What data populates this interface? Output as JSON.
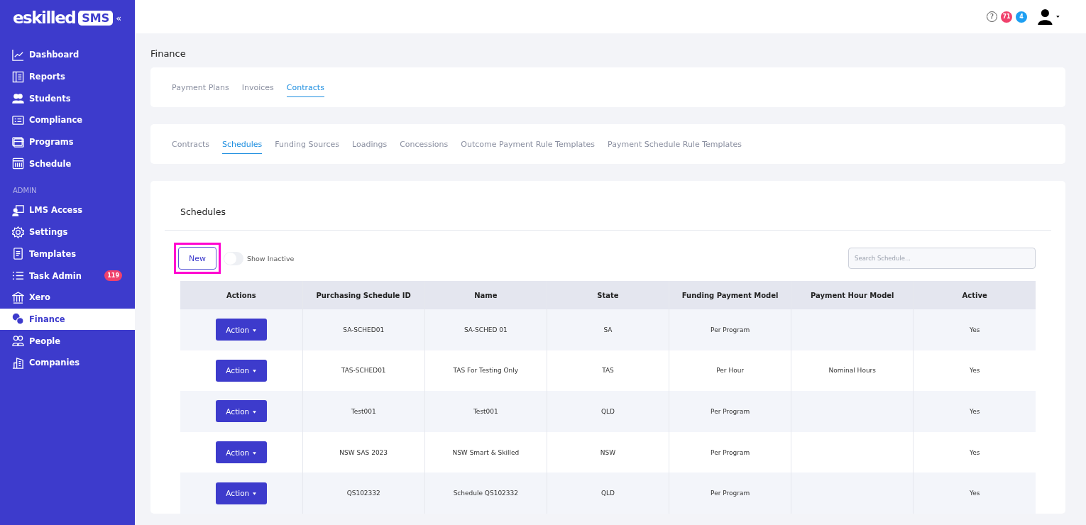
{
  "logo": {
    "brand": "skilled",
    "brand_initial": "e",
    "product": "SMS",
    "collapse": "«"
  },
  "sidebar": {
    "items": [
      {
        "label": "Dashboard",
        "selected": false
      },
      {
        "label": "Reports",
        "selected": false
      },
      {
        "label": "Students",
        "selected": false
      },
      {
        "label": "Compliance",
        "selected": false
      },
      {
        "label": "Programs",
        "selected": false
      },
      {
        "label": "Schedule",
        "selected": false
      }
    ],
    "admin_heading": "ADMIN",
    "admin_items": [
      {
        "label": "LMS Access",
        "selected": false
      },
      {
        "label": "Settings",
        "selected": false
      },
      {
        "label": "Templates",
        "selected": false
      },
      {
        "label": "Task Admin",
        "selected": false,
        "badge": "119"
      },
      {
        "label": "Xero",
        "selected": false
      },
      {
        "label": "Finance",
        "selected": true
      },
      {
        "label": "People",
        "selected": false
      },
      {
        "label": "Companies",
        "selected": false
      }
    ]
  },
  "header": {
    "help": "?",
    "badges": [
      {
        "count": "71",
        "color": "#f0416c"
      },
      {
        "count": "4",
        "color": "#1e9ff2"
      }
    ]
  },
  "page_title": "Finance",
  "tabs": [
    {
      "label": "Payment Plans",
      "selected": false
    },
    {
      "label": "Invoices",
      "selected": false
    },
    {
      "label": "Contracts",
      "selected": true
    }
  ],
  "subtabs": [
    {
      "label": "Contracts",
      "selected": false
    },
    {
      "label": "Schedules",
      "selected": true
    },
    {
      "label": "Funding Sources",
      "selected": false
    },
    {
      "label": "Loadings",
      "selected": false
    },
    {
      "label": "Concessions",
      "selected": false
    },
    {
      "label": "Outcome Payment Rule Templates",
      "selected": false
    },
    {
      "label": "Payment Schedule Rule Templates",
      "selected": false
    }
  ],
  "panel": {
    "title": "Schedules",
    "new_button": {
      "label": "New",
      "highlighted": true
    },
    "show_inactive": {
      "label": "Show Inactive",
      "on": false
    },
    "search": {
      "placeholder": "Search Schedule..."
    }
  },
  "table": {
    "columns": [
      "Actions",
      "Purchasing Schedule ID",
      "Name",
      "State",
      "Funding Payment Model",
      "Payment Hour Model",
      "Active"
    ],
    "rows": [
      {
        "cells": [
          "Action",
          "SA-SCHED01",
          "SA-SCHED 01",
          "SA",
          "Per Program",
          "",
          "Yes"
        ]
      },
      {
        "cells": [
          "Action",
          "TAS-SCHED01",
          "TAS For Testing Only",
          "TAS",
          "Per Hour",
          "Nominal Hours",
          "Yes"
        ]
      },
      {
        "cells": [
          "Action",
          "Test001",
          "Test001",
          "QLD",
          "Per Program",
          "",
          "Yes"
        ]
      },
      {
        "cells": [
          "Action",
          "NSW SAS 2023",
          "NSW Smart & Skilled",
          "NSW",
          "Per Program",
          "",
          "Yes"
        ]
      },
      {
        "cells": [
          "Action",
          "QS102332",
          "Schedule QS102332",
          "QLD",
          "Per Program",
          "",
          "Yes"
        ]
      }
    ]
  }
}
